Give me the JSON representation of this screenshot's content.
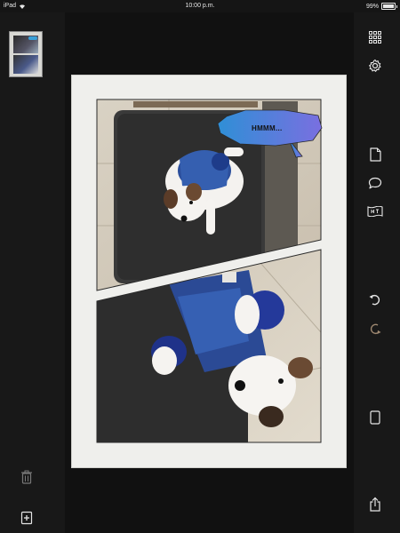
{
  "status_bar": {
    "device": "iPad",
    "time": "10:00 p.m.",
    "battery": "99%"
  },
  "left_rail": {
    "thumbnail": "page-1-thumbnail",
    "delete_icon": "trash-icon",
    "add_icon": "add-page-icon"
  },
  "right_rail": {
    "icons": [
      "grid-icon",
      "gear-icon",
      "page-icon",
      "speech-bubble-icon",
      "caption-icon",
      "undo-icon",
      "redo-icon",
      "tablet-icon",
      "share-icon"
    ]
  },
  "comic": {
    "bubble_text": "HMMM...",
    "bubble_color_start": "#2f8fd6",
    "bubble_color_end": "#7a6fe0"
  },
  "colors": {
    "background": "#151515",
    "rail": "#181818",
    "page": "#efefec",
    "icon": "#e6e6e6",
    "redo_icon": "#a08a72"
  }
}
